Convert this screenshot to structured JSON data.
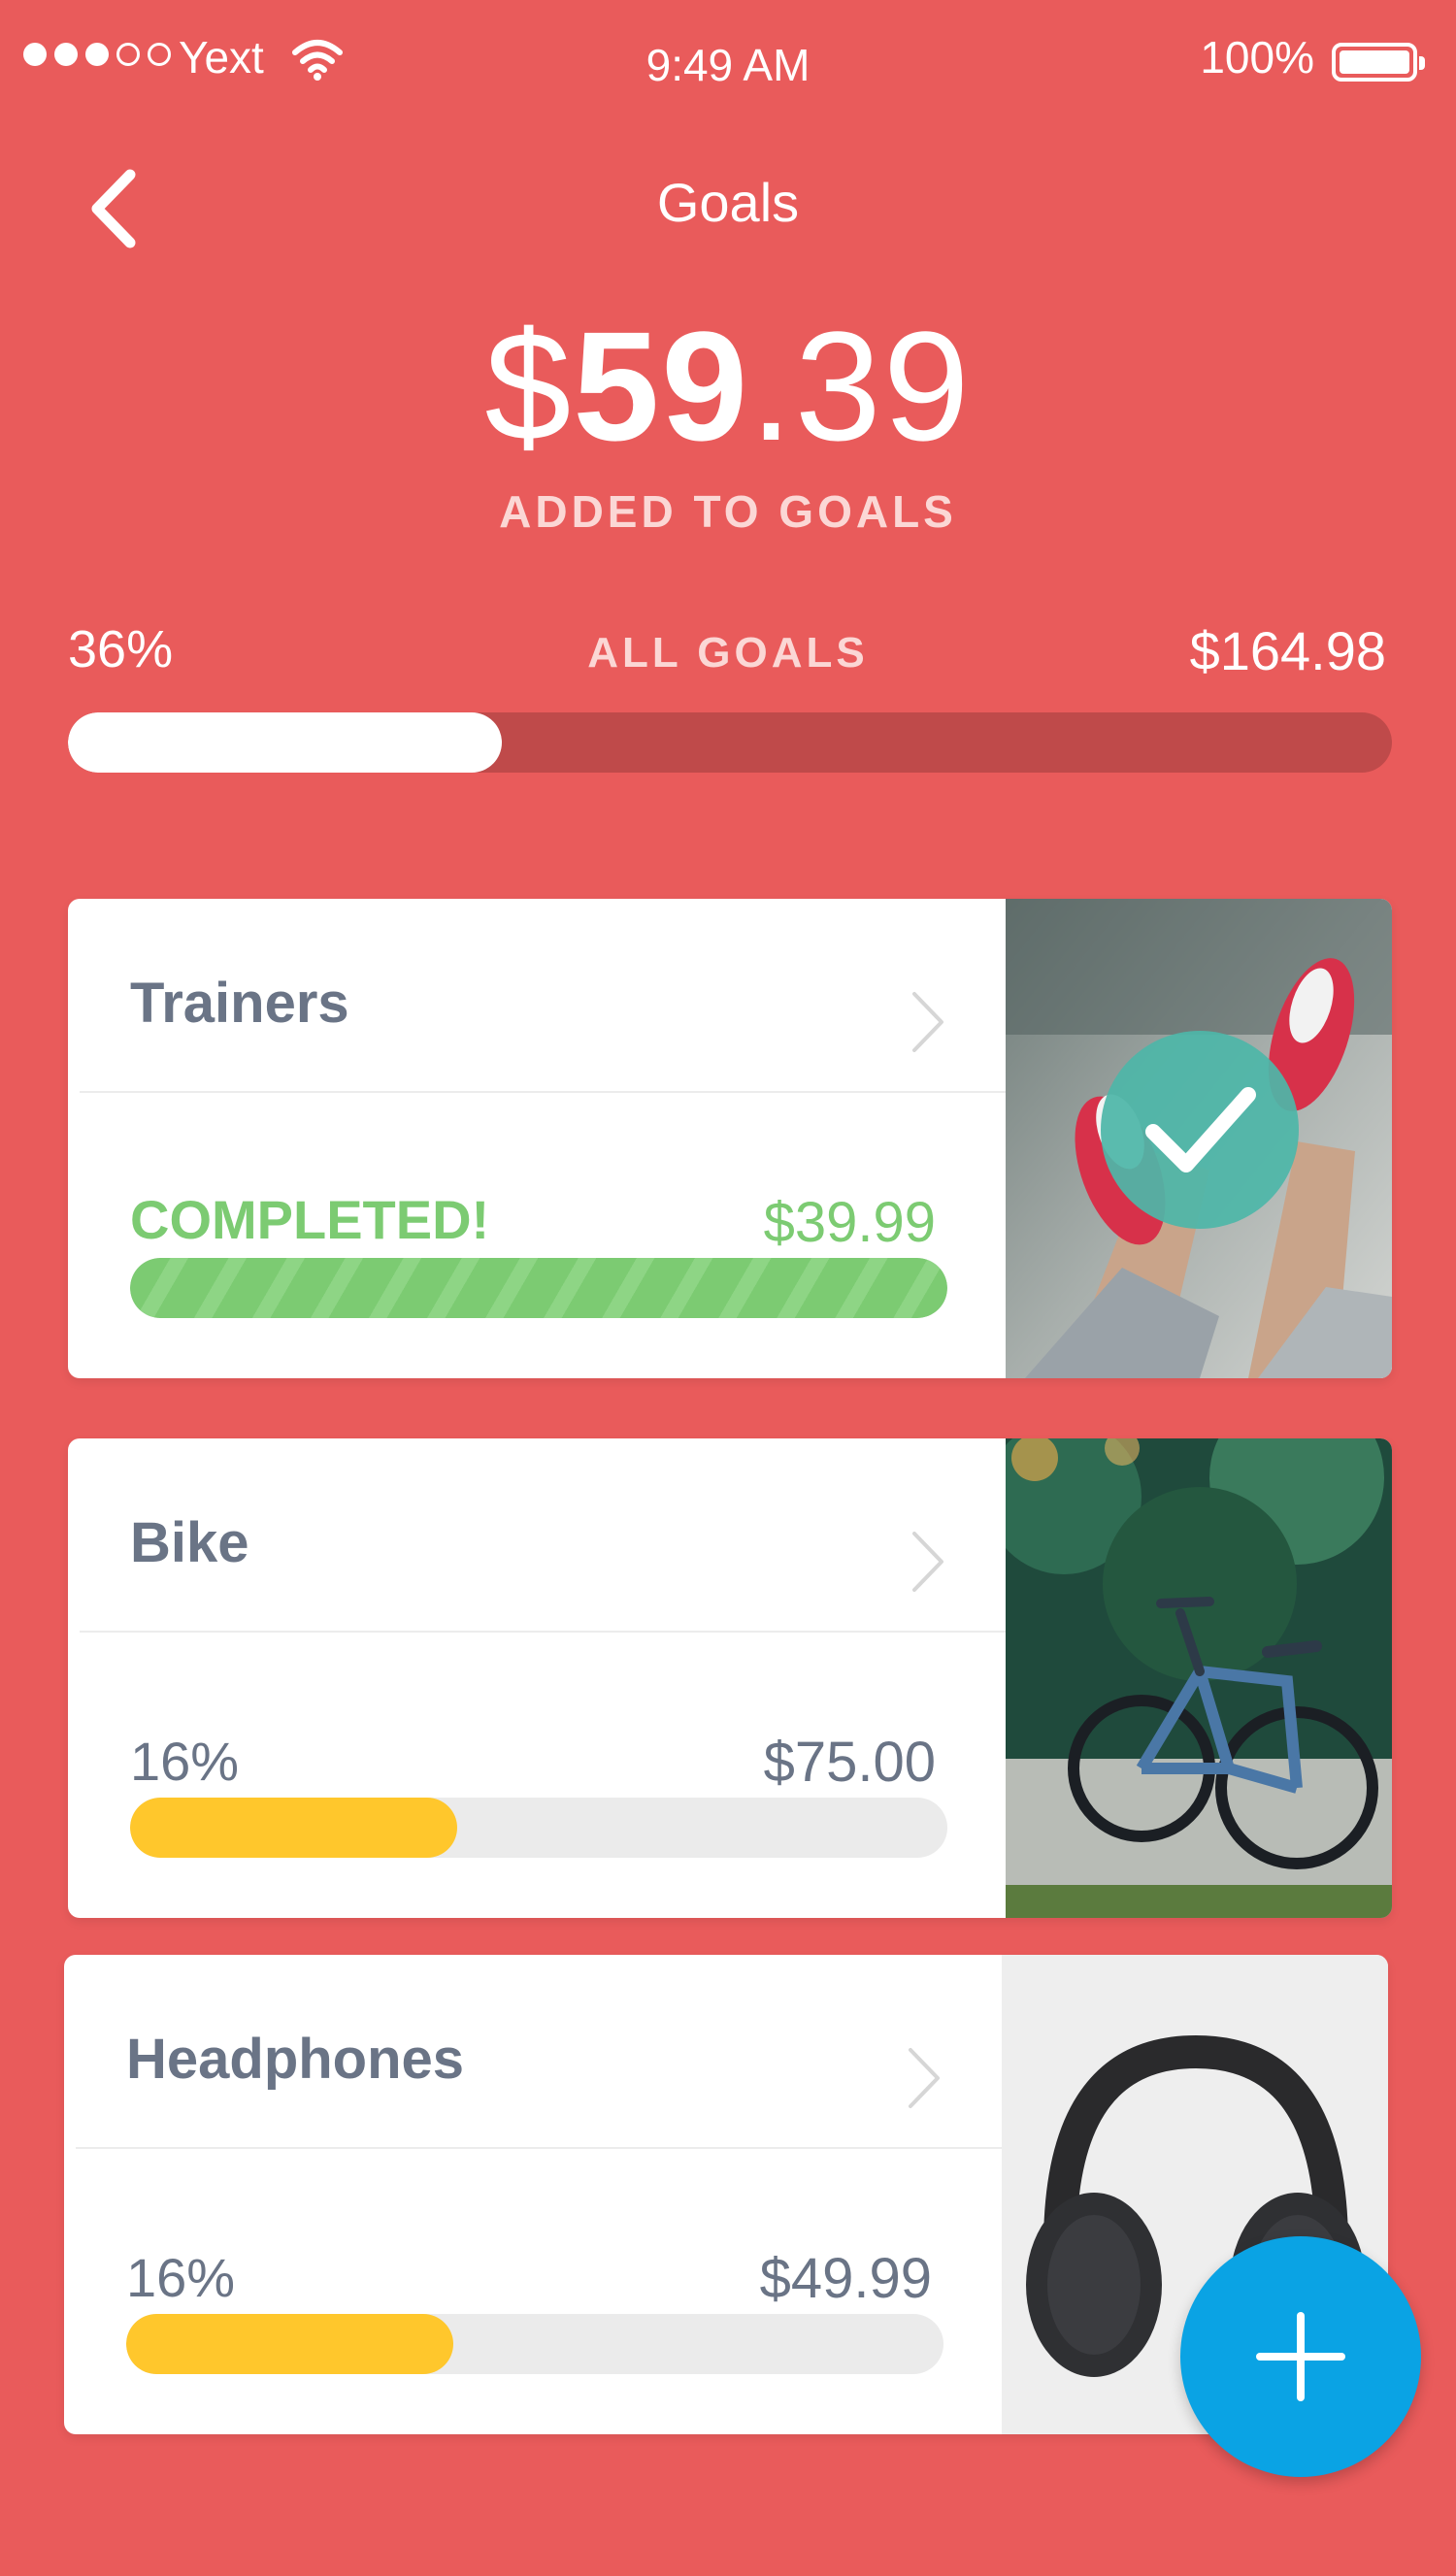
{
  "status_bar": {
    "carrier": "Yext",
    "time": "9:49 AM",
    "battery": "100%",
    "signal_bars_filled": 3,
    "signal_bars_total": 5
  },
  "nav": {
    "title": "Goals",
    "back_icon": "chevron-left-icon"
  },
  "summary": {
    "currency": "$",
    "amount_main": "59",
    "amount_cents": ".39",
    "label": "ADDED TO GOALS"
  },
  "overall": {
    "percent_label": "36%",
    "label": "ALL GOALS",
    "total": "$164.98",
    "progress": 0.36
  },
  "goals": [
    {
      "name": "Trainers",
      "status": "COMPLETED!",
      "amount": "$39.99",
      "progress": 1.0,
      "bar_color": "#7CCB72",
      "completed": true
    },
    {
      "name": "Bike",
      "status": "16%",
      "amount": "$75.00",
      "progress": 0.16,
      "bar_color": "#FFC72C",
      "completed": false
    },
    {
      "name": "Headphones",
      "status": "16%",
      "amount": "$49.99",
      "progress": 0.16,
      "bar_color": "#FFC72C",
      "completed": false
    }
  ],
  "colors": {
    "background": "#E95B5B",
    "fab": "#0AA3E4",
    "check_badge": "#4DB6A8"
  },
  "fab": {
    "icon": "plus-icon"
  }
}
